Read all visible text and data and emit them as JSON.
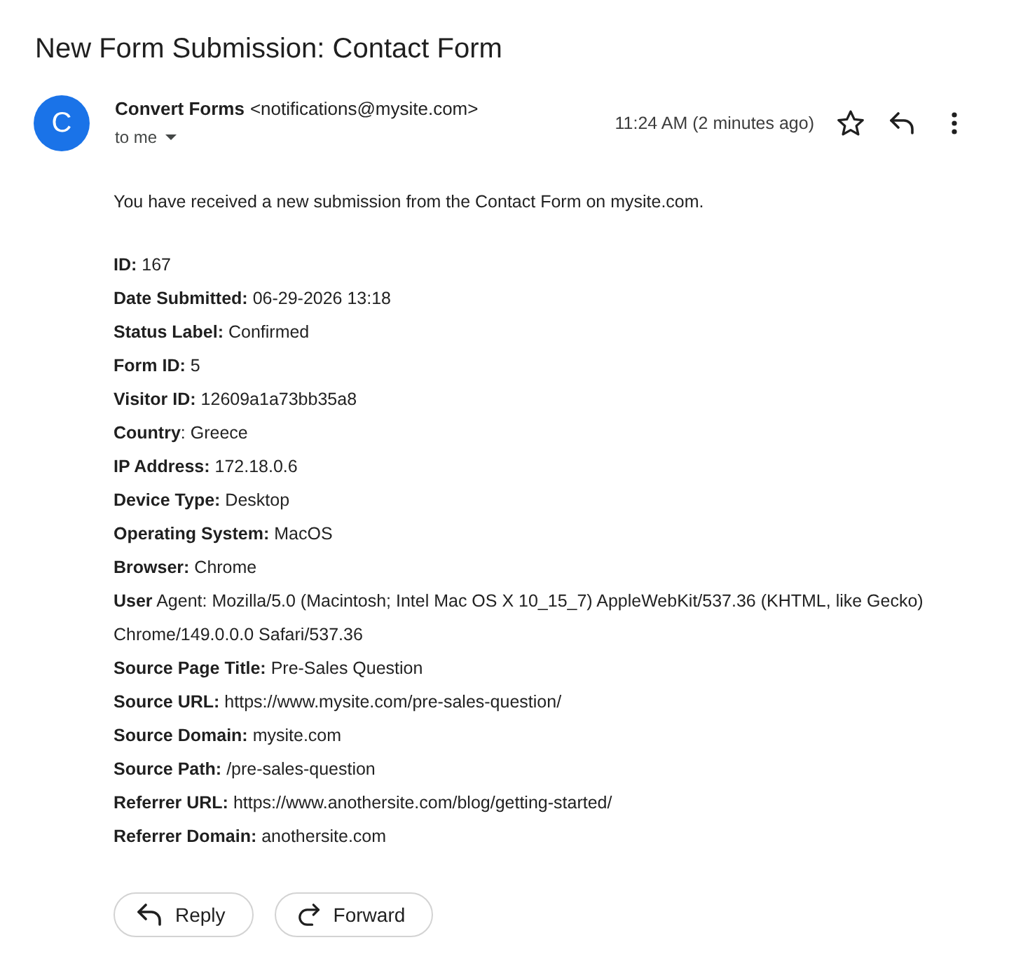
{
  "subject": "New Form Submission: Contact Form",
  "message": {
    "avatar": {
      "initial": "C"
    },
    "sender_name": "Convert Forms",
    "sender_email": "<notifications@mysite.com>",
    "recipient": "to me",
    "time": "11:24 AM (2 minutes ago)",
    "starred": false
  },
  "body": {
    "intro": "You have received a new submission from the Contact Form on mysite.com.",
    "fields": [
      "**ID:** 167",
      "**Date Submitted:** 06-29-2026 13:18",
      "**Status Label:** Confirmed",
      "**Form ID:** 5",
      "**Visitor ID:** 12609a1a73bb35a8",
      "**Country**: Greece",
      "**IP Address:** 172.18.0.6",
      "**Device Type:** Desktop",
      "**Operating System:** MacOS",
      "**Browser:** Chrome",
      "**User** Agent: Mozilla/5.0 (Macintosh; Intel Mac OS X 10_15_7) AppleWebKit/537.36 (KHTML, like Gecko) Chrome/149.0.0.0 Safari/537.36",
      "**Source Page Title:** Pre-Sales Question",
      "**Source URL:** https://www.mysite.com/pre-sales-question/",
      "**Source Domain:** mysite.com",
      "**Source Path:** /pre-sales-question",
      "**Referrer URL:** https://www.anothersite.com/blog/getting-started/",
      "**Referrer Domain:** anothersite.com"
    ]
  },
  "actions": [
    {
      "kind": "reply",
      "label": "Reply"
    },
    {
      "kind": "forward",
      "label": "Forward"
    }
  ]
}
